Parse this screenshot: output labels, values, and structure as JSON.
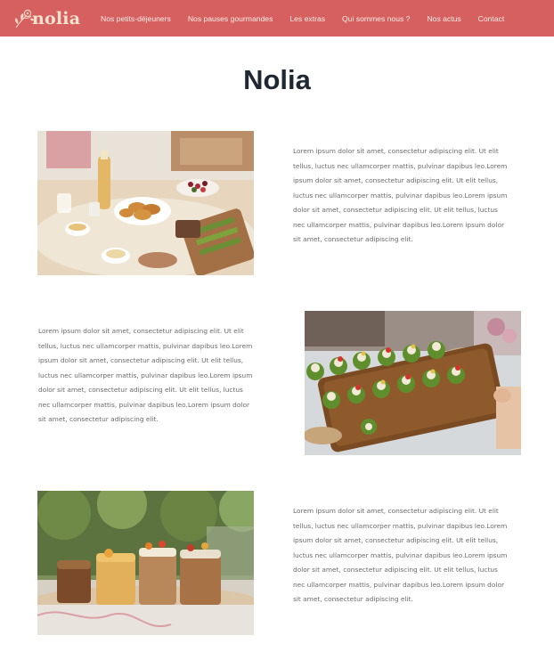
{
  "brand": {
    "name": "nolia"
  },
  "nav": {
    "items": [
      {
        "label": "Nos petits-déjeuners"
      },
      {
        "label": "Nos pauses gourmandes"
      },
      {
        "label": "Les extras"
      },
      {
        "label": "Qui sommes nous ?"
      },
      {
        "label": "Nos actus"
      },
      {
        "label": "Contact"
      }
    ]
  },
  "main": {
    "title": "Nolia",
    "sections": [
      {
        "text": "Lorem ipsum dolor sit amet, consectetur adipiscing elit. Ut elit tellus, luctus nec ullamcorper mattis, pulvinar dapibus leo.Lorem ipsum dolor sit amet, consectetur adipiscing elit. Ut elit tellus, luctus nec ullamcorper mattis, pulvinar dapibus leo.Lorem ipsum dolor sit amet, consectetur adipiscing elit. Ut elit tellus, luctus nec ullamcorper mattis, pulvinar dapibus leo.Lorem ipsum dolor sit amet, consectetur adipiscing elit."
      },
      {
        "text": "Lorem ipsum dolor sit amet, consectetur adipiscing elit. Ut elit tellus, luctus nec ullamcorper mattis, pulvinar dapibus leo.Lorem ipsum dolor sit amet, consectetur adipiscing elit. Ut elit tellus, luctus nec ullamcorper mattis, pulvinar dapibus leo.Lorem ipsum dolor sit amet, consectetur adipiscing elit. Ut elit tellus, luctus nec ullamcorper mattis, pulvinar dapibus leo.Lorem ipsum dolor sit amet, consectetur adipiscing elit."
      },
      {
        "text": "Lorem ipsum dolor sit amet, consectetur adipiscing elit. Ut elit tellus, luctus nec ullamcorper mattis, pulvinar dapibus leo.Lorem ipsum dolor sit amet, consectetur adipiscing elit. Ut elit tellus, luctus nec ullamcorper mattis, pulvinar dapibus leo.Lorem ipsum dolor sit amet, consectetur adipiscing elit. Ut elit tellus, luctus nec ullamcorper mattis, pulvinar dapibus leo.Lorem ipsum dolor sit amet, consectetur adipiscing elit."
      }
    ]
  },
  "colors": {
    "navbar": "#d65f60",
    "logo": "#f6e2cf",
    "nav_text": "#fbeee6",
    "title": "#1f2733",
    "body_text": "#6a6a6a"
  },
  "icons": {
    "logo": "flower-icon"
  }
}
